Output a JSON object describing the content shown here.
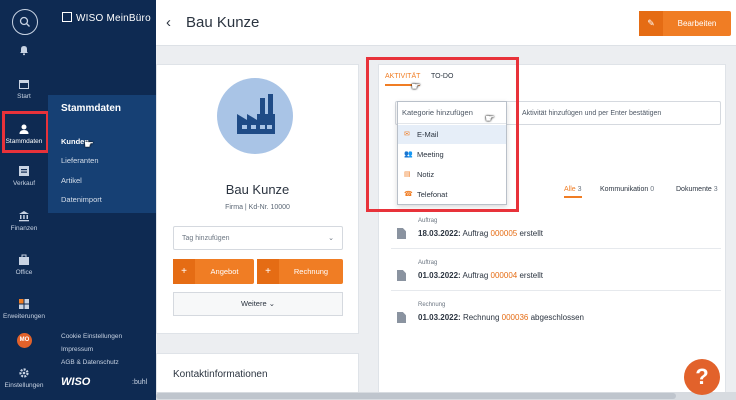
{
  "rail": {
    "items": [
      {
        "id": "start",
        "label": "Start",
        "icon": "calendar-icon"
      },
      {
        "id": "stammdaten",
        "label": "Stammdaten",
        "icon": "person-icon"
      },
      {
        "id": "verkauf",
        "label": "Verkauf",
        "icon": "cart-icon"
      },
      {
        "id": "finanzen",
        "label": "Finanzen",
        "icon": "bank-icon"
      },
      {
        "id": "office",
        "label": "Office",
        "icon": "office-icon"
      },
      {
        "id": "erweiterungen",
        "label": "Erweiterungen",
        "icon": "grid-icon"
      },
      {
        "id": "einstellungen",
        "label": "Einstellungen",
        "icon": "gear-icon"
      }
    ],
    "user_initials": "MO"
  },
  "nav": {
    "logo": "WISO MeinBüro",
    "section_title": "Stammdaten",
    "links": [
      "Kunden",
      "Lieferanten",
      "Artikel",
      "Datenimport"
    ],
    "footer": [
      "Cookie Einstellungen",
      "Impressum",
      "AGB & Datenschutz"
    ],
    "brand": "WISO",
    "buhl": ":buhl"
  },
  "header": {
    "back": "‹",
    "title": "Bau Kunze",
    "edit_label": "Bearbeiten"
  },
  "profile": {
    "name": "Bau Kunze",
    "subtitle": "Firma | Kd-Nr. 10000",
    "tag_placeholder": "Tag hinzufügen",
    "angebot": "Angebot",
    "rechnung": "Rechnung",
    "more": "Weitere",
    "contact_title": "Kontaktinformationen"
  },
  "activity": {
    "tabs": [
      "AKTIVITÄT",
      "TO-DO"
    ],
    "input_placeholder": "Aktivität hinzufügen und per Enter bestätigen",
    "dropdown": {
      "placeholder": "Kategorie hinzufügen",
      "items": [
        {
          "label": "E-Mail",
          "icon": "mail-icon"
        },
        {
          "label": "Meeting",
          "icon": "people-icon"
        },
        {
          "label": "Notiz",
          "icon": "note-icon"
        },
        {
          "label": "Telefonat",
          "icon": "phone-icon"
        }
      ]
    },
    "filters": [
      {
        "label": "Alle",
        "count": "3"
      },
      {
        "label": "Kommunikation",
        "count": "0"
      },
      {
        "label": "Dokumente",
        "count": "3"
      }
    ],
    "entries": [
      {
        "category": "Auftrag",
        "date": "18.03.2022:",
        "text_before": "Auftrag",
        "number": "000005",
        "text_after": "erstellt"
      },
      {
        "category": "Auftrag",
        "date": "01.03.2022:",
        "text_before": "Auftrag",
        "number": "000004",
        "text_after": "erstellt"
      },
      {
        "category": "Rechnung",
        "date": "01.03.2022:",
        "text_before": "Rechnung",
        "number": "000036",
        "text_after": "abgeschlossen"
      }
    ]
  },
  "help": "?",
  "colors": {
    "accent": "#f07d24",
    "sidebar": "#0e2a52",
    "highlight": "#e8323a"
  }
}
